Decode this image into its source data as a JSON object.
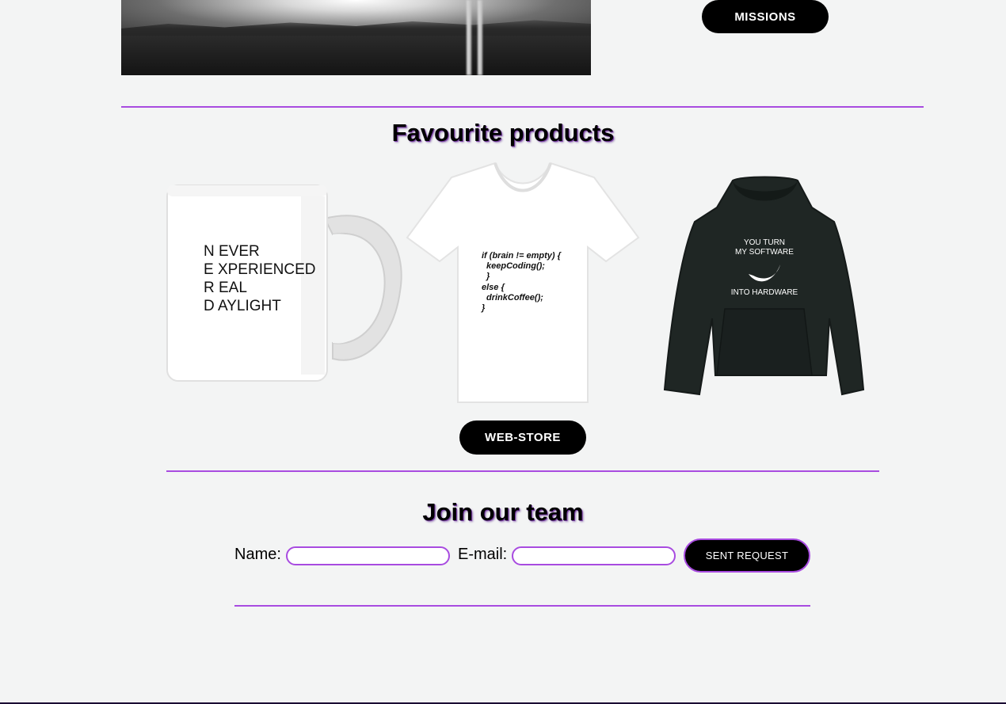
{
  "hero": {
    "missions_label": "MISSIONS"
  },
  "products_section": {
    "title": "Favourite products",
    "mug_lines": [
      "N EVER",
      "E XPERIENCED",
      "R EAL",
      "D AYLIGHT"
    ],
    "tshirt_lines": [
      "if (brain != empty) {",
      "  keepCoding();",
      "  }",
      "else {",
      "  drinkCoffee();",
      "}"
    ],
    "hoodie_lines": [
      "YOU TURN",
      "MY SOFTWARE",
      "INTO HARDWARE"
    ],
    "webstore_label": "WEB-STORE"
  },
  "join_section": {
    "title": "Join our team",
    "name_label": "Name:",
    "email_label": "E-mail:",
    "name_value": "",
    "email_value": "",
    "submit_label": "SENT REQUEST"
  },
  "colors": {
    "accent": "#a84be0",
    "background": "#f3f4f4",
    "button": "#000000"
  }
}
